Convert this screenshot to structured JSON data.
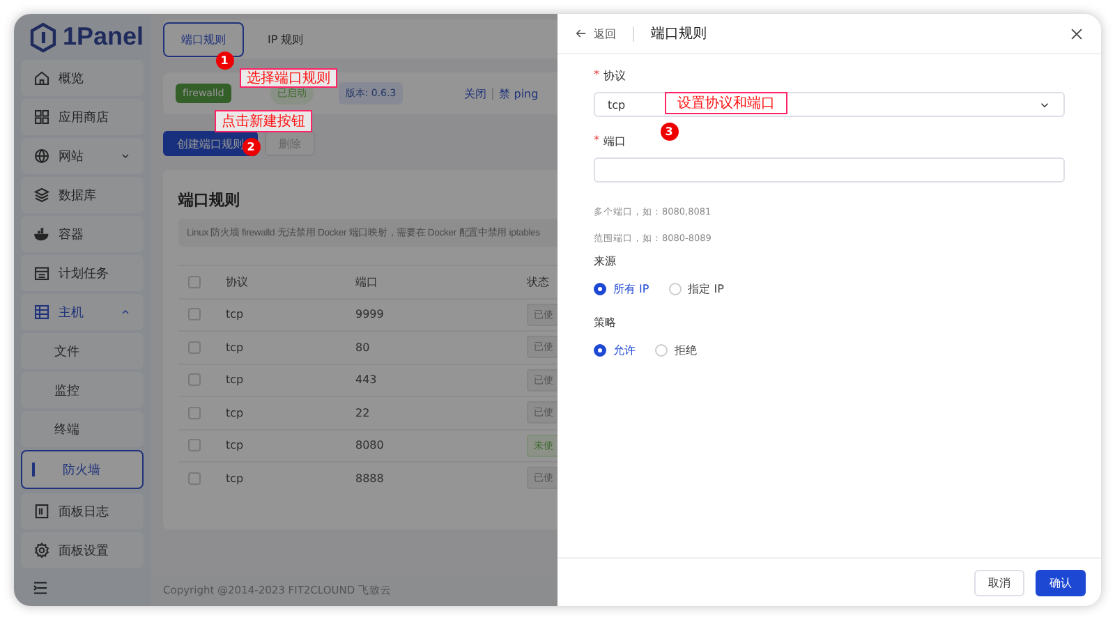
{
  "app": {
    "logo": "1Panel"
  },
  "sidebar": {
    "items": [
      {
        "label": "概览",
        "selected": false
      },
      {
        "label": "应用商店",
        "selected": false
      },
      {
        "label": "网站",
        "selected": false,
        "expanded": false
      },
      {
        "label": "数据库",
        "selected": false
      },
      {
        "label": "容器",
        "selected": false
      },
      {
        "label": "计划任务",
        "selected": false
      },
      {
        "label": "主机",
        "selected": false,
        "expanded": true,
        "children": [
          {
            "label": "文件",
            "selected": false
          },
          {
            "label": "监控",
            "selected": false
          },
          {
            "label": "终端",
            "selected": false
          },
          {
            "label": "防火墙",
            "selected": true
          }
        ]
      },
      {
        "label": "面板日志",
        "selected": false
      },
      {
        "label": "面板设置",
        "selected": false
      }
    ]
  },
  "tabs": [
    {
      "label": "端口规则",
      "selected": true
    },
    {
      "label": "IP 规则",
      "selected": false
    }
  ],
  "status_bar": {
    "service": "firewalld",
    "state": "已启动",
    "version": "版本: 0.6.3",
    "actions": [
      "关闭",
      "禁 ping"
    ]
  },
  "toolbar": [
    {
      "label": "创建端口规则",
      "kind": "primary"
    },
    {
      "label": "删除",
      "kind": "disabled"
    }
  ],
  "table": {
    "title": "端口规则",
    "notice": "Linux 防火墙 firewalld 无法禁用 Docker 端口映射，需要在 Docker 配置中禁用 iptables",
    "header_checked": false,
    "columns": [
      "协议",
      "端口",
      "状态"
    ],
    "rows": [
      {
        "checked": false,
        "protocol": "tcp",
        "port": "9999",
        "status": "已使",
        "kind": "used"
      },
      {
        "checked": false,
        "protocol": "tcp",
        "port": "80",
        "status": "已使",
        "kind": "used"
      },
      {
        "checked": false,
        "protocol": "tcp",
        "port": "443",
        "status": "已使",
        "kind": "used"
      },
      {
        "checked": false,
        "protocol": "tcp",
        "port": "22",
        "status": "已使",
        "kind": "used"
      },
      {
        "checked": false,
        "protocol": "tcp",
        "port": "8080",
        "status": "未使",
        "kind": "unused"
      },
      {
        "checked": false,
        "protocol": "tcp",
        "port": "8888",
        "status": "已使",
        "kind": "used"
      }
    ]
  },
  "footer": "Copyright @2014-2023 FIT2CLOUND 飞致云",
  "annotations": [
    {
      "number": "1",
      "text": "选择端口规则"
    },
    {
      "number": "2",
      "text": "点击新建按钮"
    },
    {
      "number": "3",
      "text": "设置协议和端口"
    }
  ],
  "drawer": {
    "back": "返回",
    "title": "端口规则",
    "fields": [
      {
        "mark": "*",
        "label": "协议",
        "kind": "select",
        "value": "tcp"
      },
      {
        "mark": "*",
        "label": "端口",
        "kind": "input",
        "hints": [
          "多个端口，如：8080,8081",
          "范围端口，如：8080-8089"
        ]
      }
    ],
    "radio_groups": [
      {
        "label": "来源",
        "options": [
          {
            "label": "所有 IP",
            "selected": true
          },
          {
            "label": "指定 IP",
            "selected": false
          }
        ]
      },
      {
        "label": "策略",
        "options": [
          {
            "label": "允许",
            "selected": true
          },
          {
            "label": "拒绝",
            "selected": false
          }
        ]
      }
    ],
    "buttons": [
      {
        "label": "取消",
        "kind": "default"
      },
      {
        "label": "确认",
        "kind": "primary"
      }
    ]
  }
}
